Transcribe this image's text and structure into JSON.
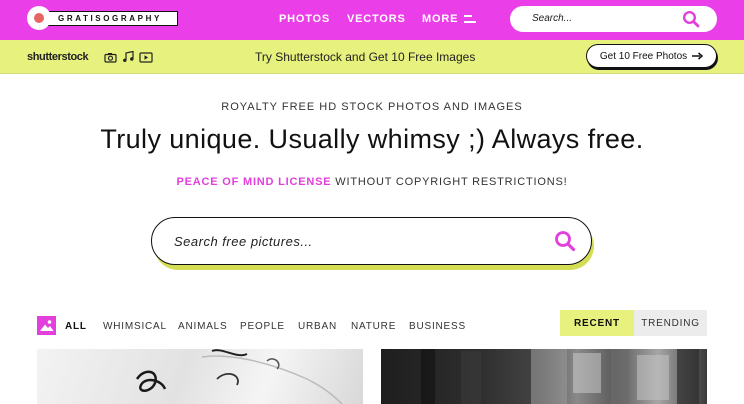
{
  "header": {
    "logo_text": "GRATISOGRAPHY",
    "nav": {
      "photos": "PHOTOS",
      "vectors": "VECTORS",
      "more": "MORE"
    },
    "search_placeholder": "Search..."
  },
  "promo": {
    "brand": "shutterstock",
    "text": "Try Shutterstock and Get 10 Free Images",
    "button_label": "Get 10 Free Photos"
  },
  "hero": {
    "eyebrow": "ROYALTY FREE HD STOCK PHOTOS AND IMAGES",
    "headline": "Truly unique. Usually whimsy ;) Always free.",
    "license_link": "PEACE OF MIND LICENSE",
    "license_rest": " WITHOUT COPYRIGHT RESTRICTIONS!",
    "search_placeholder": "Search free pictures..."
  },
  "filters": {
    "categories": [
      "ALL",
      "WHIMSICAL",
      "ANIMALS",
      "PEOPLE",
      "URBAN",
      "NATURE",
      "BUSINESS"
    ],
    "sort": {
      "recent": "RECENT",
      "trending": "TRENDING"
    }
  },
  "colors": {
    "brand_magenta": "#ea3ee8",
    "accent_lime": "#e7f17d",
    "license_pink": "#e23fdc"
  },
  "icons": {
    "search": "search-icon",
    "menu": "hamburger-icon",
    "camera": "camera-icon",
    "music": "music-note-icon",
    "video": "video-play-icon",
    "arrow": "arrow-right-icon",
    "image": "image-icon"
  }
}
